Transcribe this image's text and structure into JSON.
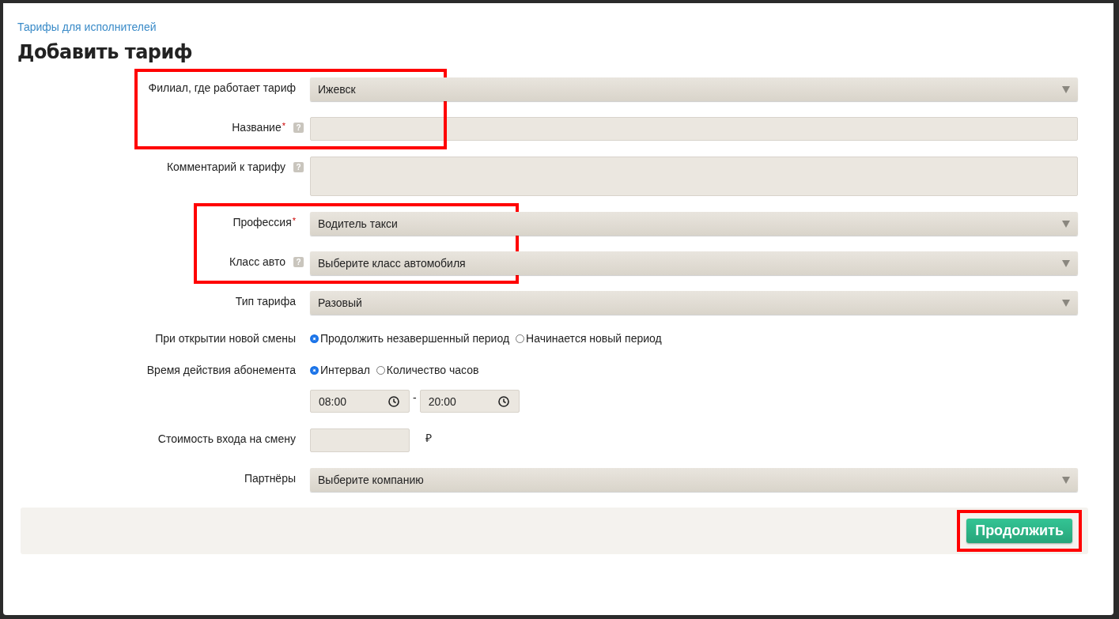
{
  "breadcrumb": "Тарифы для исполнителей",
  "title": "Добавить тариф",
  "groups": [
    {
      "highlighted": true,
      "rows": [
        {
          "kind": "select",
          "label": "Филиал, где работает тариф",
          "value": "Ижевск"
        },
        {
          "kind": "text",
          "label": "Название",
          "required_mark": "*",
          "help_mark": "?"
        }
      ]
    },
    {
      "highlighted": false,
      "rows": [
        {
          "kind": "textarea",
          "label": "Комментарий к тарифу",
          "help_mark": "?"
        }
      ]
    },
    {
      "highlighted": true,
      "rows": [
        {
          "kind": "select",
          "label": "Профессия",
          "required_mark": "*",
          "value": "Водитель такси"
        },
        {
          "kind": "select",
          "label": "Класс авто",
          "help_mark": "?",
          "value": "Выберите класс автомобиля"
        }
      ]
    },
    {
      "highlighted": false,
      "rows": [
        {
          "kind": "select",
          "label": "Тип тарифа",
          "value": "Разовый"
        },
        {
          "kind": "radio",
          "label": "При открытии новой смены",
          "options": [
            {
              "label": "Продолжить незавершенный период",
              "selected": true
            },
            {
              "label": "Начинается новый период",
              "selected": false
            }
          ]
        },
        {
          "kind": "radio",
          "label": "Время действия абонемента",
          "options": [
            {
              "label": "Интервал",
              "selected": true
            },
            {
              "label": "Количество часов",
              "selected": false
            }
          ]
        },
        {
          "kind": "time_range",
          "from": "08:00",
          "separator": "-",
          "to": "20:00"
        },
        {
          "kind": "money",
          "label": "Стоимость входа на смену",
          "currency": "₽"
        },
        {
          "kind": "select",
          "label": "Партнёры",
          "value": "Выберите компанию"
        }
      ]
    }
  ],
  "submit": {
    "label": "Продолжить",
    "highlighted": true
  }
}
